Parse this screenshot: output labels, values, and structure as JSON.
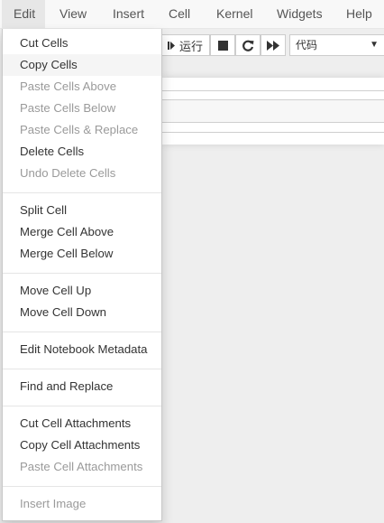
{
  "menubar": {
    "items": [
      {
        "label": "Edit",
        "open": true
      },
      {
        "label": "View"
      },
      {
        "label": "Insert"
      },
      {
        "label": "Cell"
      },
      {
        "label": "Kernel"
      },
      {
        "label": "Widgets"
      },
      {
        "label": "Help"
      }
    ]
  },
  "toolbar": {
    "run_label": "运行",
    "cell_type_selected": "代码"
  },
  "edit_menu": {
    "items": [
      {
        "label": "Cut Cells",
        "enabled": true
      },
      {
        "label": "Copy Cells",
        "enabled": true,
        "hover": true
      },
      {
        "label": "Paste Cells Above",
        "enabled": false
      },
      {
        "label": "Paste Cells Below",
        "enabled": false
      },
      {
        "label": "Paste Cells & Replace",
        "enabled": false
      },
      {
        "label": "Delete Cells",
        "enabled": true
      },
      {
        "label": "Undo Delete Cells",
        "enabled": false
      },
      {
        "label": "Split Cell",
        "enabled": true
      },
      {
        "label": "Merge Cell Above",
        "enabled": true
      },
      {
        "label": "Merge Cell Below",
        "enabled": true
      },
      {
        "label": "Move Cell Up",
        "enabled": true
      },
      {
        "label": "Move Cell Down",
        "enabled": true
      },
      {
        "label": "Edit Notebook Metadata",
        "enabled": true
      },
      {
        "label": "Find and Replace",
        "enabled": true
      },
      {
        "label": "Cut Cell Attachments",
        "enabled": true
      },
      {
        "label": "Copy Cell Attachments",
        "enabled": true
      },
      {
        "label": "Paste Cell Attachments",
        "enabled": false
      },
      {
        "label": "Insert Image",
        "enabled": false
      }
    ]
  },
  "colors": {
    "menubar_bg": "#f8f8f8",
    "open_menu_bg": "#e7e7e7",
    "disabled_text": "#9a9a9a",
    "enabled_text": "#333333",
    "hover_bg": "#f5f5f5"
  }
}
